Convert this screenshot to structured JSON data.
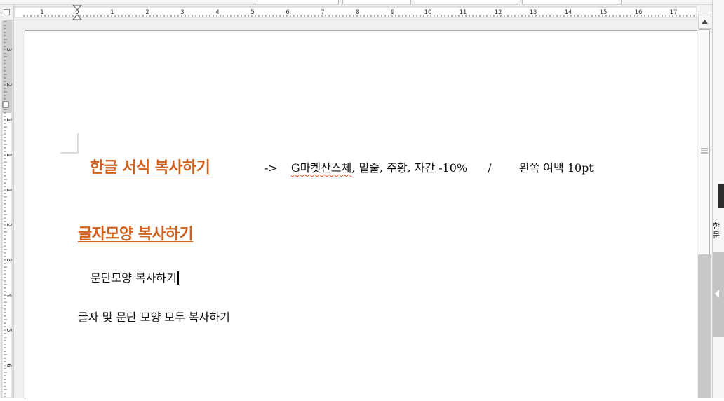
{
  "document": {
    "lines": [
      {
        "heading": "한글 서식 복사하기",
        "arrow": "->",
        "note_spell": "G마켓산스체",
        "note_rest": ", 밑줄, 주황, 자간 -10%",
        "slash": "/",
        "note_right": "왼쪽 여백 10pt"
      },
      {
        "heading": "글자모양 복사하기"
      },
      {
        "text": "문단모양 복사하기"
      },
      {
        "text": "글자 및 문단 모양 모두 복사하기"
      }
    ]
  },
  "rulers": {
    "h_labels": [
      "1",
      "0",
      "1",
      "2",
      "3",
      "4",
      "5",
      "6",
      "7",
      "8",
      "9",
      "10",
      "11",
      "12",
      "13",
      "14",
      "15",
      "16",
      "17"
    ],
    "v_labels": [
      "3",
      "2",
      "1",
      "1",
      "1",
      "2",
      "3",
      "4",
      "5",
      "6"
    ]
  },
  "right_panel": {
    "text": "한 문"
  },
  "colors": {
    "heading": "#d0601c",
    "spell_underline": "#d94b2b",
    "ruler_bg": "#f0f0f0",
    "page_bg": "#ffffff"
  },
  "icons": [
    "scroll-up-arrow-icon",
    "scroll-grip-icon",
    "panel-collapse-arrow-icon",
    "ruler-corner-icon",
    "paragraph-margin-mark-icon",
    "indent-marker-icon"
  ]
}
